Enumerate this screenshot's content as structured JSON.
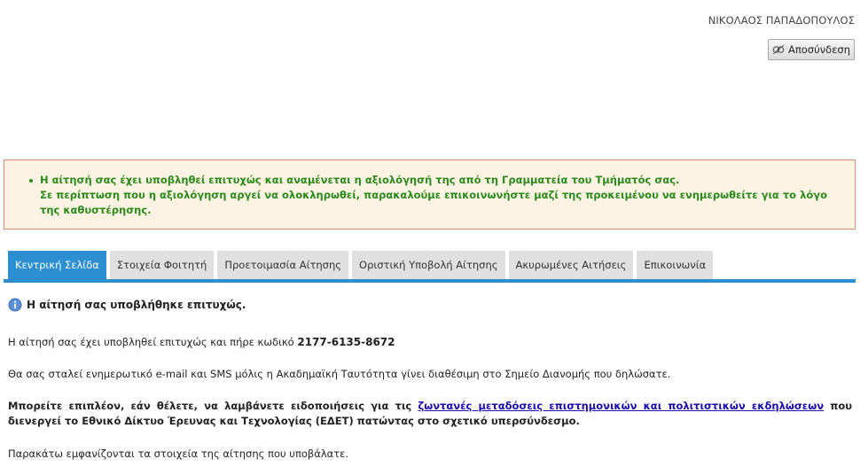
{
  "header": {
    "user_name": "ΝΙΚΟΛΑΟΣ ΠΑΠΑΔΟΠΟΥΛΟΣ",
    "logout_label": "Αποσύνδεση",
    "logout_icon": "logout-icon"
  },
  "alert": {
    "line1": "Η αίτησή σας έχει υποβληθεί επιτυχώς και αναμένεται η αξιολόγησή της από τη Γραμματεία του Τμήματός σας.",
    "line2": "Σε περίπτωση που η αξιολόγηση αργεί να ολοκληρωθεί, παρακαλούμε επικοινωνήστε μαζί της προκειμένου να ενημερωθείτε για το λόγο της καθυστέρησης.",
    "text_color": "#2b8a1f",
    "background": "#fcf3e2",
    "border_color": "#e08f7d"
  },
  "tabs": [
    {
      "label": "Κεντρική Σελίδα",
      "active": true
    },
    {
      "label": "Στοιχεία Φοιτητή",
      "active": false
    },
    {
      "label": "Προετοιμασία Αίτησης",
      "active": false
    },
    {
      "label": "Οριστική Υποβολή Αίτησης",
      "active": false
    },
    {
      "label": "Ακυρωμένες Αιτήσεις",
      "active": false
    },
    {
      "label": "Επικοινωνία",
      "active": false
    }
  ],
  "accent_color": "#2b8fd0",
  "main": {
    "title": "Η αίτησή σας υποβλήθηκε επιτυχώς.",
    "title_icon": "info-icon",
    "p1_text": "Η αίτησή σας έχει υποβληθεί επιτυχώς και πήρε κωδικό ",
    "code": "2177-6135-8672",
    "p2_text": "Θα σας σταλεί ενημερωτικό e-mail και SMS μόλις η Ακαδημαϊκή Ταυτότητα γίνει διαθέσιμη στο Σημείο Διανομής που δηλώσατε.",
    "p3_before": "Μπορείτε επιπλέον, εάν θέλετε, να λαμβάνετε ειδοποιήσεις για τις ",
    "p3_link": "ζωντανές μεταδόσεις επιστημονικών και πολιτιστικών εκδηλώσεων",
    "p3_after": " που διενεργεί το Εθνικό Δίκτυο Έρευνας και Τεχνολογίας (ΕΔΕΤ) πατώντας στο σχετικό υπερσύνδεσμο.",
    "p4_text": "Παρακάτω εμφανίζονται τα στοιχεία της αίτησης που υποβάλατε."
  }
}
